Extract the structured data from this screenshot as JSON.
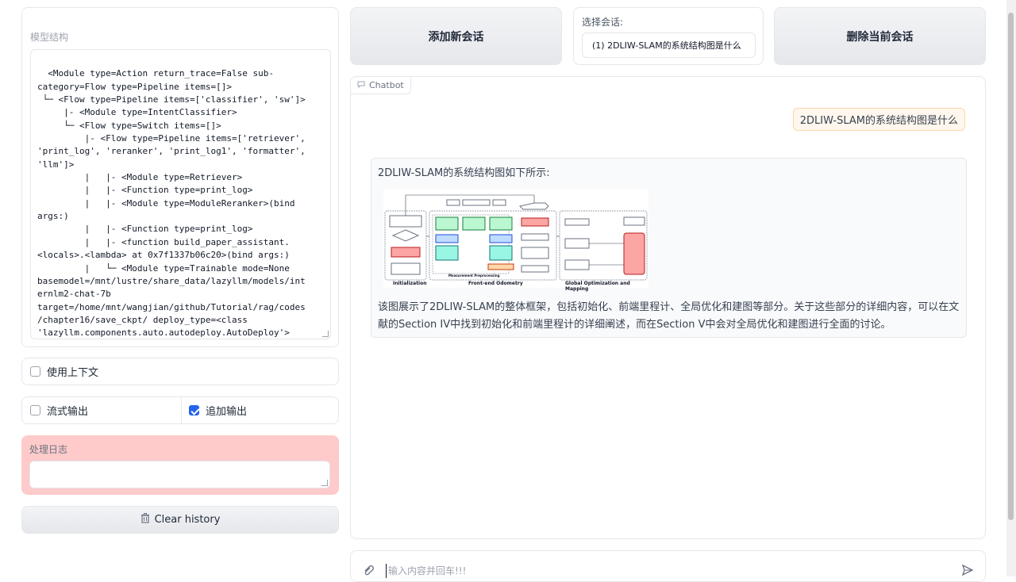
{
  "left": {
    "model_structure_label": "模型结构",
    "model_structure_text": "<Module type=Action return_trace=False sub-\ncategory=Flow type=Pipeline items=[]>\n └─ <Flow type=Pipeline items=['classifier', 'sw']>\n     |- <Module type=IntentClassifier>\n     └─ <Flow type=Switch items=[]>\n         |- <Flow type=Pipeline items=['retriever',\n'print_log', 'reranker', 'print_log1', 'formatter',\n'llm']>\n         |   |- <Module type=Retriever>\n         |   |- <Function type=print_log>\n         |   |- <Module type=ModuleReranker>(bind\nargs:)\n         |   |- <Function type=print_log>\n         |   |- <function build_paper_assistant.\n<locals>.<lambda> at 0x7f1337b06c20>(bind args:)\n         |   └─ <Module type=Trainable mode=None\nbasemodel=/mnt/lustre/share_data/lazyllm/models/int\nernlm2-chat-7b\ntarget=/home/mnt/wangjian/github/Tutorial/rag/codes\n/chapter16/save_ckpt/ deploy_type=<class\n'lazyllm.components.auto.autodeploy.AutoDeploy'>\nstream=False return_trace=False>",
    "use_context_label": "使用上下文",
    "stream_output_label": "流式输出",
    "append_output_label": "追加输出",
    "log_label": "处理日志",
    "log_value": "",
    "clear_history_label": "Clear history"
  },
  "top": {
    "add_session_label": "添加新会话",
    "select_session_label": "选择会话:",
    "selected_session": "(1)  2DLIW-SLAM的系统结构图是什么",
    "delete_session_label": "删除当前会话"
  },
  "chat": {
    "chatbot_label": "Chatbot",
    "user_message": "2DLIW-SLAM的系统结构图是什么",
    "bot_intro": "2DLIW-SLAM的系统结构图如下所示:",
    "bot_body": "该图展示了2DLIW-SLAM的整体框架，包括初始化、前端里程计、全局优化和建图等部分。关于这些部分的详细内容，可以在文献的Section IV中找到初始化和前端里程计的详细阐述，而在Section V中会对全局优化和建图进行全面的讨论。",
    "input_placeholder": "输入内容并回车!!!"
  },
  "diagram": {
    "section_initialization": "Initialization",
    "section_frontend": "Front-end Odometry",
    "section_global": "Global Optimization and Mapping",
    "measurement": "Measurement Preprocessing"
  }
}
